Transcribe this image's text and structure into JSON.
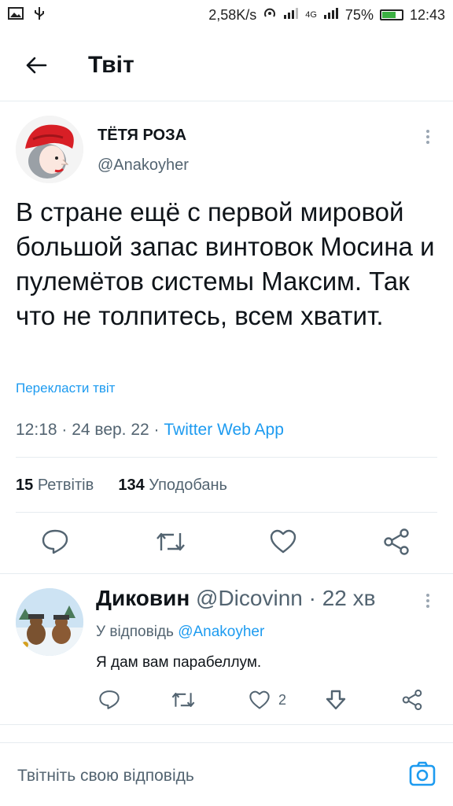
{
  "status_bar": {
    "speed": "2,58K/s",
    "network": "4G",
    "battery": "75%",
    "battery_level": 0.75,
    "time": "12:43"
  },
  "header": {
    "title": "Твіт"
  },
  "tweet": {
    "author_name": "ТЁТЯ РОЗА",
    "author_handle": "@Anakoyher",
    "text": "В стране ещё с первой мировой большой запас винтовок Мосина и пулемётов системы Максим. Так что не толпитесь, всем хватит.",
    "translate_label": "Перекласти твіт",
    "meta_prefix": "12:18 · 24 вер. 22 · ",
    "source": "Twitter Web App",
    "retweets_count": "15",
    "retweets_label": "Ретвітів",
    "likes_count": "134",
    "likes_label": "Уподобань"
  },
  "reply": {
    "author_name": "Диковин",
    "author_handle": "@Dicovinn",
    "time": "· 22 хв",
    "replying_to_label": "У відповідь ",
    "replying_to_handle": "@Anakoyher",
    "text": "Я дам вам парабеллум.",
    "like_count": "2"
  },
  "composer": {
    "placeholder": "Твітніть свою відповідь"
  },
  "colors": {
    "accent": "#1d9bf0",
    "text": "#0f1419",
    "muted": "#536471",
    "divider": "#e6ecf0"
  }
}
